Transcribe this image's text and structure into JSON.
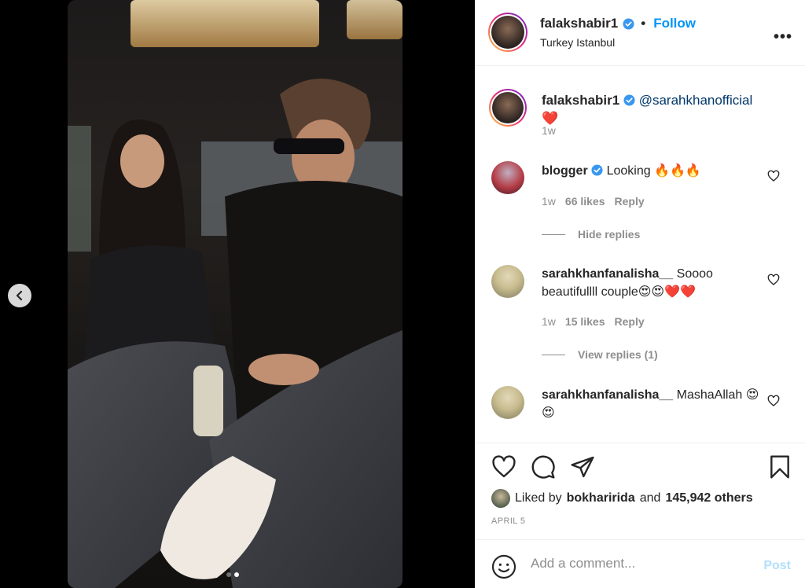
{
  "media": {
    "prev_icon": "chevron-left-icon",
    "slide_count": 2,
    "active_slide": 2
  },
  "header": {
    "username": "falakshabir1",
    "verified_icon": "verified-badge-icon",
    "separator": "•",
    "follow_label": "Follow",
    "location": "Turkey Istanbul",
    "more_icon": "more-options-icon",
    "more_label": "•••"
  },
  "caption": {
    "username": "falakshabir1",
    "mention": "@sarahkhanofficial",
    "emoji": "❤️",
    "time": "1w"
  },
  "comments": [
    {
      "username": "blogger",
      "verified": true,
      "text": "Looking 🔥🔥🔥",
      "time": "1w",
      "likes": "66 likes",
      "reply_label": "Reply",
      "replies_toggle": "Hide replies"
    },
    {
      "username": "sarahkhanfanalisha__",
      "text": "Soooo beautifullll couple😍😍❤️❤️",
      "time": "1w",
      "likes": "15 likes",
      "reply_label": "Reply",
      "replies_toggle": "View replies (1)"
    },
    {
      "username": "sarahkhanfanalisha__",
      "text": "MashaAllah 😍😍"
    }
  ],
  "actions": {
    "like_icon": "heart-icon",
    "comment_icon": "comment-icon",
    "share_icon": "paper-plane-icon",
    "save_icon": "bookmark-icon",
    "liked_prefix": "Liked by",
    "liked_user": "bokharirida",
    "liked_and": "and",
    "liked_others": "145,942 others",
    "date": "APRIL 5"
  },
  "add_comment": {
    "emoji_icon": "smiley-icon",
    "placeholder": "Add a comment...",
    "post_label": "Post"
  },
  "colors": {
    "accent": "#0095f6",
    "mention": "#00376b",
    "muted": "#8e8e8e",
    "post_disabled": "#b2dffc"
  }
}
